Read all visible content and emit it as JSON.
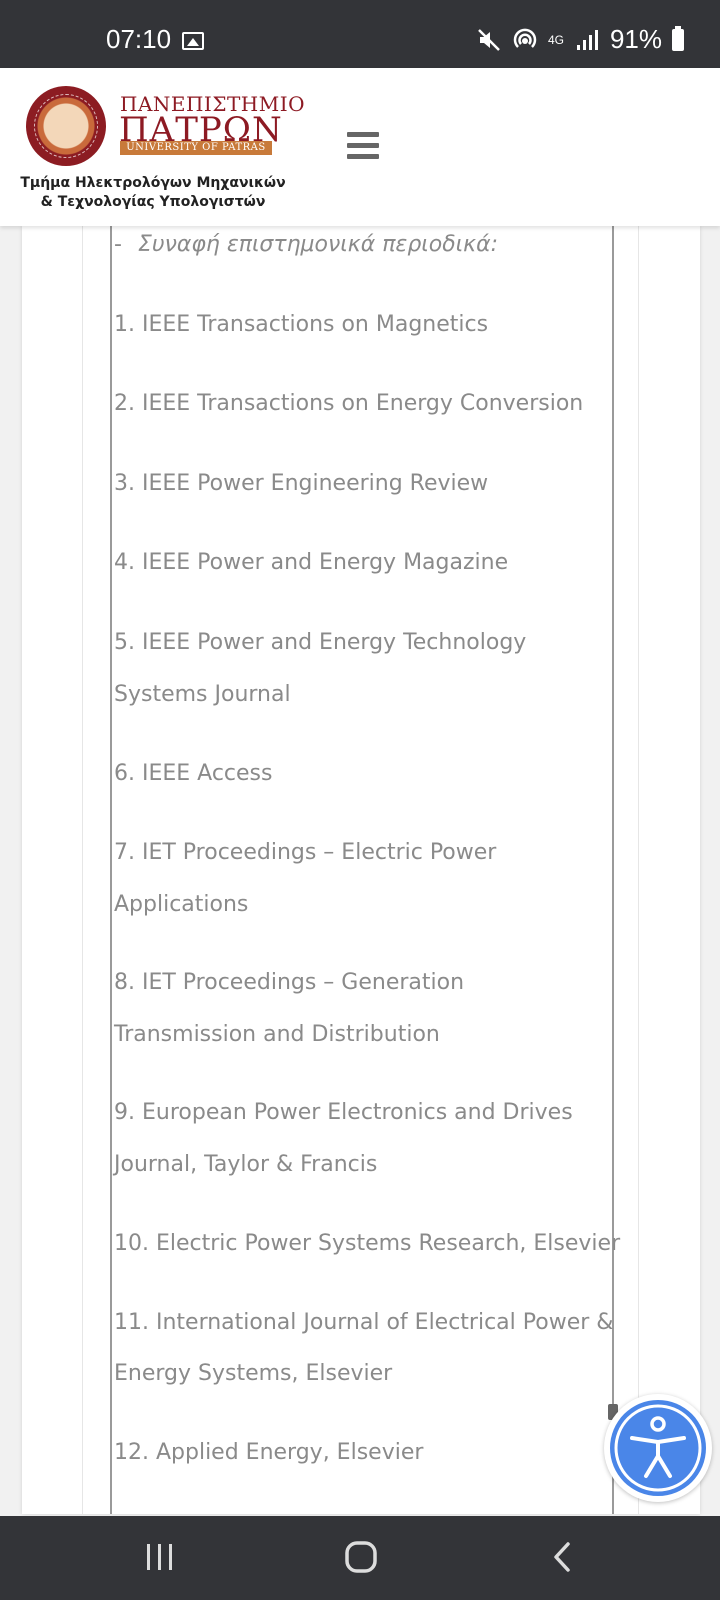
{
  "status_bar": {
    "time": "07:10",
    "network": "4G",
    "battery": "91%",
    "icons": [
      "gallery-icon",
      "mute-icon",
      "hotspot-icon",
      "network-4g-icon",
      "signal-icon",
      "battery-icon"
    ]
  },
  "header": {
    "university_line1": "ΠΑΝΕΠΙΣΤΗΜΙΟ",
    "university_line2": "ΠΑΤΡΩΝ",
    "university_en": "UNIVERSITY OF PATRAS",
    "department_line1": "Τμήμα Ηλεκτρολόγων Μηχανικών",
    "department_line2": "& Τεχνολογίας Υπολογιστών",
    "menu_icon": "hamburger-menu-icon"
  },
  "content": {
    "subheading": "Συναφή επιστημονικά περιοδικά:",
    "dash": "-",
    "journals": [
      {
        "lines": [
          "1.    IEEE Transactions on Magnetics"
        ]
      },
      {
        "lines": [
          "2.    IEEE Transactions on Energy Conversion"
        ]
      },
      {
        "lines": [
          "3.    IEEE Power Engineering Review"
        ]
      },
      {
        "lines": [
          "4.    IEEE Power and Energy Magazine"
        ]
      },
      {
        "lines": [
          "5.    IEEE Power and Energy Technology",
          "Systems Journal"
        ]
      },
      {
        "lines": [
          "6.    IEEE Access"
        ]
      },
      {
        "lines": [
          "7.    IET Proceedings – Electric Power",
          "Applications"
        ]
      },
      {
        "lines": [
          "8.    IET Proceedings – Generation",
          "Transmission and Distribution"
        ]
      },
      {
        "lines": [
          "9.    European Power Electronics and Drives",
          "Journal, Taylor & Francis"
        ]
      },
      {
        "lines": [
          "10. Electric Power Systems Research, Elsevier"
        ]
      },
      {
        "lines": [
          "11. International Journal of Electrical Power &",
          "Energy Systems, Elsevier"
        ]
      },
      {
        "lines": [
          "12. Applied Energy, Elsevier"
        ]
      }
    ]
  },
  "accessibility_widget": {
    "icon": "accessibility-icon",
    "color": "#4a86e8"
  },
  "nav_bar": {
    "icons": [
      "recent-apps-icon",
      "home-icon",
      "back-icon"
    ]
  }
}
